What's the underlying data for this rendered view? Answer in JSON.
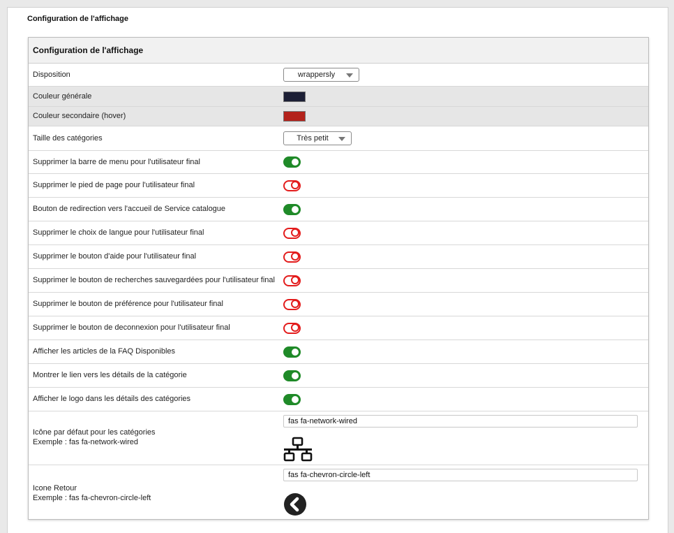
{
  "page": {
    "title": "Configuration de l'affichage"
  },
  "panel": {
    "title": "Configuration de l'affichage"
  },
  "rows": {
    "disposition": {
      "label": "Disposition",
      "value": "wrappersly"
    },
    "couleur_generale": {
      "label": "Couleur générale",
      "color": "#1c1f35"
    },
    "couleur_secondaire": {
      "label": "Couleur secondaire (hover)",
      "color": "#b3221b"
    },
    "taille_categories": {
      "label": "Taille des catégories",
      "value": "Très petit"
    },
    "toggles": [
      {
        "label": "Supprimer la barre de menu pour l'utilisateur final",
        "on": true
      },
      {
        "label": "Supprimer le pied de page pour l'utilisateur final",
        "on": false
      },
      {
        "label": "Bouton de redirection vers l'accueil de Service catalogue",
        "on": true
      },
      {
        "label": "Supprimer le choix de langue pour l'utilisateur final",
        "on": false
      },
      {
        "label": "Supprimer le bouton d'aide pour l'utilisateur final",
        "on": false
      },
      {
        "label": "Supprimer le bouton de recherches sauvegardées pour l'utilisateur final",
        "on": false
      },
      {
        "label": "Supprimer le bouton de préférence pour l'utilisateur final",
        "on": false
      },
      {
        "label": "Supprimer le bouton de deconnexion pour l'utilisateur final",
        "on": false
      },
      {
        "label": "Afficher les articles de la FAQ Disponibles",
        "on": true
      },
      {
        "label": "Montrer le lien vers les détails de la catégorie",
        "on": true
      },
      {
        "label": "Afficher le logo dans les détails des catégories",
        "on": true
      }
    ],
    "icone_defaut": {
      "label": "Icône par défaut pour les catégories",
      "example": "Exemple : fas fa-network-wired",
      "value": "fas fa-network-wired",
      "icon": "network-wired-icon"
    },
    "icone_retour": {
      "label": "Icone Retour",
      "example": "Exemple : fas fa-chevron-circle-left",
      "value": "fas fa-chevron-circle-left",
      "icon": "chevron-circle-left-icon"
    }
  }
}
